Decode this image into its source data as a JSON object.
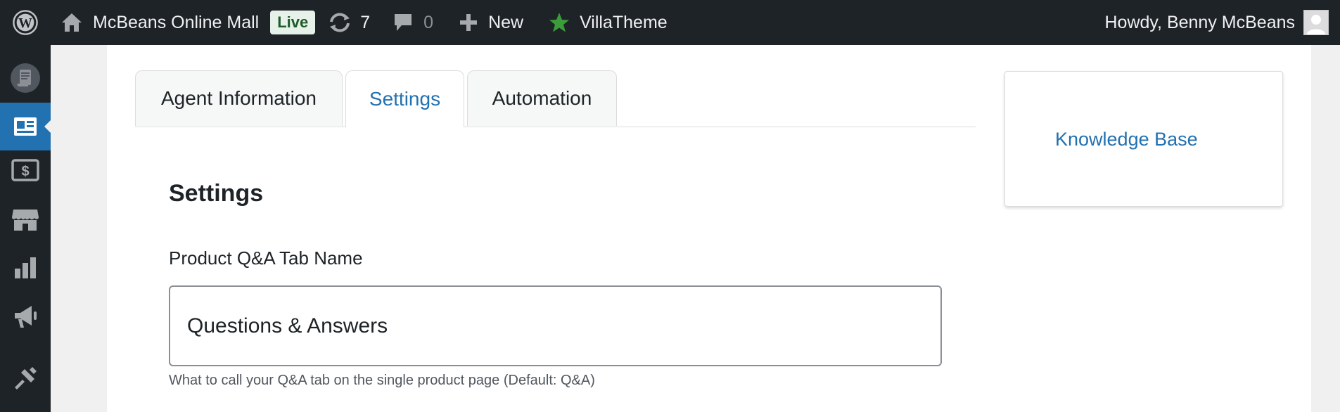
{
  "admin_bar": {
    "site_name": "McBeans Online Mall",
    "live_badge": "Live",
    "updates_count": "7",
    "comments_count": "0",
    "new_label": "New",
    "villatheme_label": "VillaTheme",
    "greeting": "Howdy, Benny McBeans",
    "icons": [
      "wordpress-icon",
      "home-icon",
      "updates-icon",
      "comment-icon",
      "plus-icon",
      "star-icon",
      "avatar"
    ],
    "colors": {
      "background": "#1d2327",
      "star": "#3a9d3a"
    }
  },
  "sidebar": {
    "items": [
      {
        "icon": "scroll-icon",
        "current": false
      },
      {
        "icon": "id-card-icon",
        "current": true
      },
      {
        "icon": "dollar-icon",
        "current": false
      },
      {
        "icon": "store-icon",
        "current": false
      },
      {
        "icon": "bar-chart-icon",
        "current": false
      },
      {
        "icon": "megaphone-icon",
        "current": false
      },
      {
        "icon": "paintbrush-icon",
        "current": false
      }
    ],
    "accent": "#2271b1"
  },
  "tabs": [
    {
      "label": "Agent Information",
      "active": false
    },
    {
      "label": "Settings",
      "active": true
    },
    {
      "label": "Automation",
      "active": false
    }
  ],
  "settings": {
    "title": "Settings",
    "tab_name_label": "Product Q&A Tab Name",
    "tab_name_value": "Questions & Answers",
    "tab_name_help": "What to call your Q&A tab on the single product page (Default: Q&A)"
  },
  "side_box": {
    "link_label": "Knowledge Base"
  }
}
